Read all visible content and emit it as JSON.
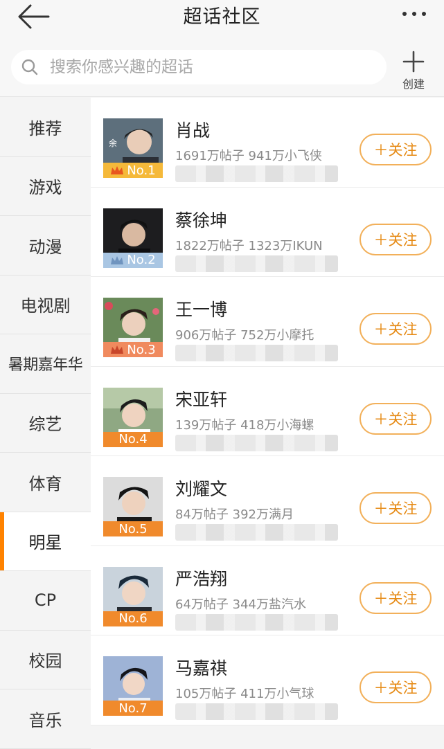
{
  "header": {
    "title": "超话社区",
    "back_icon": "back-arrow-icon",
    "more_icon": "more-dots-icon"
  },
  "search": {
    "placeholder": "搜索你感兴趣的超话",
    "create_label": "创建"
  },
  "sidebar": {
    "items": [
      {
        "label": "推荐",
        "active": false
      },
      {
        "label": "游戏",
        "active": false
      },
      {
        "label": "动漫",
        "active": false
      },
      {
        "label": "电视剧",
        "active": false
      },
      {
        "label": "暑期嘉年华",
        "active": false
      },
      {
        "label": "综艺",
        "active": false
      },
      {
        "label": "体育",
        "active": false
      },
      {
        "label": "明星",
        "active": true
      },
      {
        "label": "CP",
        "active": false
      },
      {
        "label": "校园",
        "active": false
      },
      {
        "label": "音乐",
        "active": false
      }
    ]
  },
  "list": {
    "follow_label": "＋关注",
    "items": [
      {
        "name": "肖战",
        "stats": "1691万帖子 941万小飞侠",
        "rank": "No.1",
        "rank_color": "#f5b93a",
        "crown": true
      },
      {
        "name": "蔡徐坤",
        "stats": "1822万帖子 1323万IKUN",
        "rank": "No.2",
        "rank_color": "#a9c6e3",
        "crown": true
      },
      {
        "name": "王一博",
        "stats": "906万帖子 752万小摩托",
        "rank": "No.3",
        "rank_color": "#f08a5e",
        "crown": true
      },
      {
        "name": "宋亚轩",
        "stats": "139万帖子 418万小海螺",
        "rank": "No.4",
        "rank_color": "#f08a2c",
        "crown": false
      },
      {
        "name": "刘耀文",
        "stats": "84万帖子 392万满月",
        "rank": "No.5",
        "rank_color": "#f08a2c",
        "crown": false
      },
      {
        "name": "严浩翔",
        "stats": "64万帖子 344万盐汽水",
        "rank": "No.6",
        "rank_color": "#f08a2c",
        "crown": false
      },
      {
        "name": "马嘉祺",
        "stats": "105万帖子 411万小气球",
        "rank": "No.7",
        "rank_color": "#f08a2c",
        "crown": false
      }
    ]
  },
  "colors": {
    "accent": "#ff8200",
    "follow_border": "#f2b05a",
    "follow_text": "#e68a14"
  }
}
